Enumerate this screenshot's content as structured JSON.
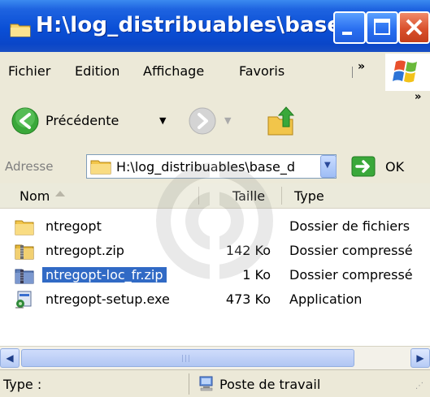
{
  "window": {
    "title": "H:\\log_distribuables\\base_...",
    "buttons": {
      "minimize": "minimize-icon",
      "maximize": "maximize-icon",
      "close": "close-icon"
    }
  },
  "menu": {
    "items": [
      "Fichier",
      "Edition",
      "Affichage",
      "Favoris"
    ],
    "overflow": "»"
  },
  "toolbar": {
    "back_label": "Précédente",
    "overflow": "»"
  },
  "address": {
    "label": "Adresse",
    "value": "H:\\log_distribuables\\base_d",
    "go_label": "OK"
  },
  "list": {
    "columns": [
      "Nom",
      "Taille",
      "Type"
    ],
    "rows": [
      {
        "name": "ntregopt",
        "size": "",
        "type": "Dossier de fichiers",
        "icon": "folder-icon",
        "selected": false
      },
      {
        "name": "ntregopt.zip",
        "size": "142 Ko",
        "type": "Dossier compressé",
        "icon": "zip-folder-icon",
        "selected": false
      },
      {
        "name": "ntregopt-loc_fr.zip",
        "size": "1 Ko",
        "type": "Dossier compressé",
        "icon": "zip-folder-icon",
        "selected": true
      },
      {
        "name": "ntregopt-setup.exe",
        "size": "473 Ko",
        "type": "Application",
        "icon": "setup-exe-icon",
        "selected": false
      }
    ]
  },
  "status": {
    "left": "Type :",
    "right": "Poste de travail"
  },
  "colors": {
    "titlebar": "#0a4fd6",
    "selection": "#316ac5",
    "chrome": "#ece9d8"
  }
}
